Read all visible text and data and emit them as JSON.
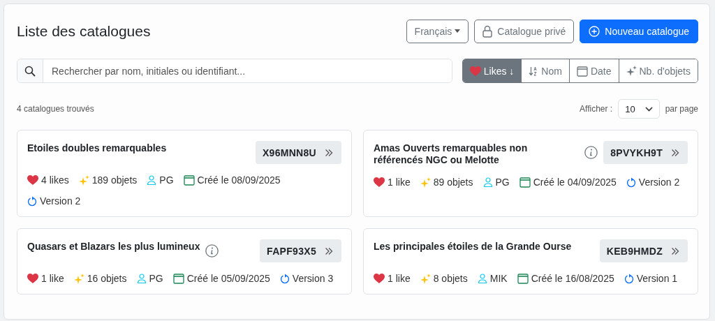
{
  "header": {
    "title": "Liste des catalogues",
    "language_button": "Français",
    "private_button": "Catalogue privé",
    "new_button": "Nouveau catalogue"
  },
  "search": {
    "placeholder": "Rechercher par nom, initiales ou identifiant..."
  },
  "sort_options": [
    {
      "label": "Likes ↓",
      "kind": "heart",
      "selected": true
    },
    {
      "label": "Nom",
      "kind": "alpha",
      "selected": false
    },
    {
      "label": "Date",
      "kind": "calendar",
      "selected": false
    },
    {
      "label": "Nb. d'objets",
      "kind": "sparkles",
      "selected": false
    }
  ],
  "results_count": "4 catalogues trouvés",
  "page_size": {
    "label": "Afficher :",
    "value": "10",
    "suffix": "par page"
  },
  "catalogs": [
    {
      "title": "Etoiles doubles remarquables",
      "info": false,
      "code": "X96MNN8U",
      "likes": "4 likes",
      "objects": "189 objets",
      "author": "PG",
      "created": "Créé le 08/09/2025",
      "version": "Version 2"
    },
    {
      "title": "Amas Ouverts remarquables non référencés NGC ou Melotte",
      "info": true,
      "code": "8PVYKH9T",
      "likes": "1 like",
      "objects": "89 objets",
      "author": "PG",
      "created": "Créé le 04/09/2025",
      "version": "Version 2"
    },
    {
      "title": "Quasars et Blazars les plus lumineux",
      "info": true,
      "code": "FAPF93X5",
      "likes": "1 like",
      "objects": "16 objets",
      "author": "PG",
      "created": "Créé le 05/09/2025",
      "version": "Version 3"
    },
    {
      "title": "Les principales étoiles de la Grande Ourse",
      "info": false,
      "code": "KEB9HMDZ",
      "likes": "1 like",
      "objects": "8 objets",
      "author": "MIK",
      "created": "Créé le 16/08/2025",
      "version": "Version 1"
    }
  ]
}
